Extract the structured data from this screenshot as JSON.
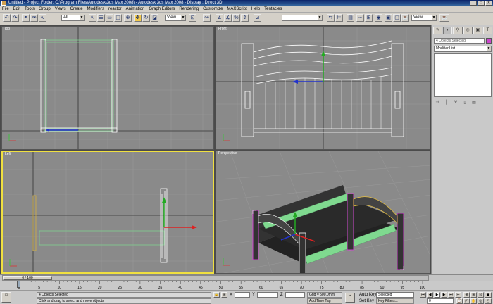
{
  "titlebar": {
    "title": "Untitled    - Project Folder: C:\\Program Files\\Autodesk\\3ds Max 2008\\    - Autodesk 3ds Max 2008    - Display : Direct 3D",
    "min_label": "_",
    "max_label": "□",
    "close_label": "✕"
  },
  "menu": [
    "File",
    "Edit",
    "Tools",
    "Group",
    "Views",
    "Create",
    "Modifiers",
    "reactor",
    "Animation",
    "Graph Editors",
    "Rendering",
    "Customize",
    "MAXScript",
    "Help",
    "Tentacles"
  ],
  "toolbar": {
    "selection_filter": "All",
    "coord_system": "View",
    "named_selection": "",
    "render_type": "View"
  },
  "viewports": {
    "top": {
      "label": "Top"
    },
    "front": {
      "label": "Front"
    },
    "left": {
      "label": "Left"
    },
    "perspective": {
      "label": "Perspective"
    }
  },
  "command_panel": {
    "object_name": "4 Objects Selected",
    "modifier_list": "Modifier List"
  },
  "timeline": {
    "frame_counter": "0 / 100",
    "ticks": [
      "0",
      "5",
      "10",
      "15",
      "20",
      "25",
      "30",
      "35",
      "40",
      "45",
      "50",
      "55",
      "60",
      "65",
      "70",
      "75",
      "80",
      "85",
      "90",
      "95",
      "100"
    ]
  },
  "status": {
    "selection_info": "4 Objects Selected",
    "prompt": "Click and drag to select and move objects",
    "x_label": "X",
    "y_label": "Y",
    "z_label": "Z",
    "x_value": "",
    "y_value": "",
    "z_value": "",
    "grid": "Grid = 500.0mm",
    "add_time_tag": "Add Time Tag",
    "auto_key": "Auto Key",
    "auto_key_mode": "Selected",
    "set_key": "Set Key",
    "key_filters": "Key Filters...",
    "current_frame": "0"
  },
  "colors": {
    "viewport_bg": "#8a8a8a",
    "active_border": "#f0e040",
    "selection_white": "#ffffff",
    "rail_green": "#7fd98f",
    "post_magenta": "#cc44cc"
  }
}
